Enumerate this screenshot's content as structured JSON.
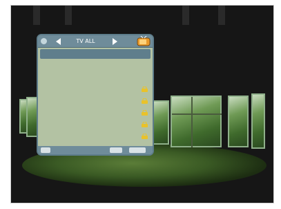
{
  "menu": {
    "header_title": "TV ALL",
    "footer_label": "",
    "channels": [
      {
        "number": "",
        "name": "",
        "locked": false,
        "selected": true
      },
      {
        "number": "",
        "name": "",
        "locked": false,
        "selected": false
      },
      {
        "number": "",
        "name": "",
        "locked": false,
        "selected": false
      },
      {
        "number": "",
        "name": "",
        "locked": true,
        "selected": false
      },
      {
        "number": "",
        "name": "",
        "locked": true,
        "selected": false
      },
      {
        "number": "",
        "name": "",
        "locked": true,
        "selected": false
      },
      {
        "number": "",
        "name": "",
        "locked": true,
        "selected": false
      },
      {
        "number": "",
        "name": "",
        "locked": true,
        "selected": false
      }
    ]
  },
  "icons": {
    "prev": "chevron-left-icon",
    "next": "chevron-right-icon",
    "tv": "tv-icon",
    "lock": "lock-icon"
  },
  "colors": {
    "panel": "#b3c2a3",
    "header": "#6f8c9a",
    "highlight": "#5f7e8c",
    "lock": "#e9c22a"
  }
}
